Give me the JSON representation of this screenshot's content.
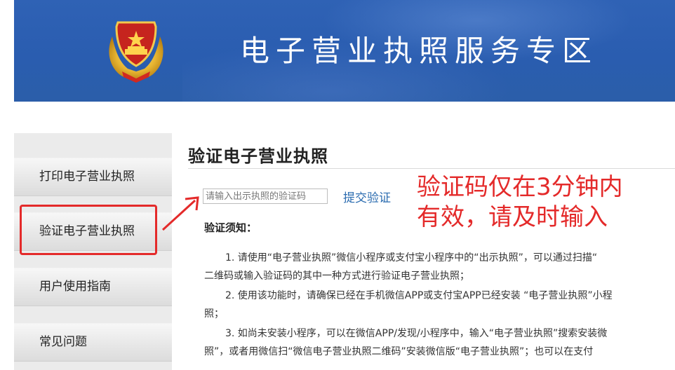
{
  "header": {
    "title": "电子营业执照服务专区",
    "emblem": "national-emblem-icon"
  },
  "sidebar": {
    "items": [
      {
        "label": "打印电子营业执照"
      },
      {
        "label": "验证电子营业执照"
      },
      {
        "label": "用户使用指南"
      },
      {
        "label": "常见问题"
      }
    ]
  },
  "main": {
    "title": "验证电子营业执照",
    "code_input": {
      "placeholder": "请输入出示执照的验证码",
      "value": ""
    },
    "submit_label": "提交验证",
    "annotation": {
      "line1": "验证码仅在3分钟内",
      "line2": "有效，请及时输入",
      "color": "#e42a2a"
    },
    "notice_heading": "验证须知：",
    "paragraphs": [
      {
        "line1": "1. 请使用“电子营业执照”微信小程序或支付宝小程序中的“出示执照”，可以通过扫描“",
        "line2": "二维码或输入验证码的其中一种方式进行验证电子营业执照；"
      },
      {
        "line1": "2. 使用该功能时，请确保已经在手机微信APP或支付宝APP已经安装 “电子营业执照”小程",
        "line2": "照；"
      },
      {
        "line1": "3. 如尚未安装小程序，可以在微信APP/发现/小程序中，输入“电子营业执照”搜索安装微",
        "line2": "照”，或者用微信扫“微信电子营业执照二维码”安装微信版“电子营业执照”；也可以在支付"
      }
    ]
  },
  "colors": {
    "banner_blue": "#2f62b5",
    "link_blue": "#2b6cb0",
    "highlight_red": "#e42a2a"
  }
}
